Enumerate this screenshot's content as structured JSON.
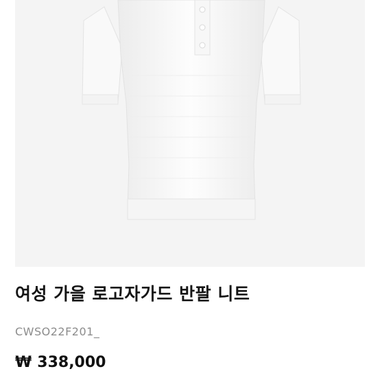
{
  "product": {
    "image_subject": "white short-sleeve polo knit",
    "title": "여성 가을 로고자가드 반팔 니트",
    "code": "CWSO22F201_",
    "currency_symbol": "₩",
    "price": "338,000"
  },
  "colors": {
    "image_background": "#f4f4f4",
    "garment": "#fbfbfb",
    "title_text": "#151515",
    "code_text": "#8c8c8c",
    "price_text": "#111111"
  }
}
